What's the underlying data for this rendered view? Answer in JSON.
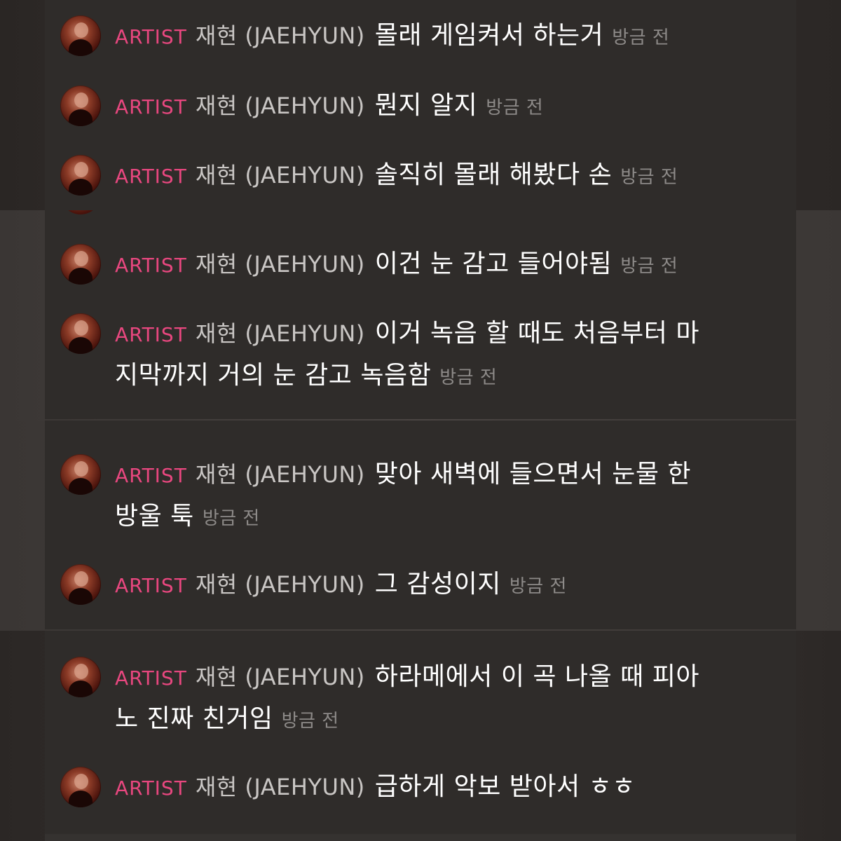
{
  "artist_badge": "ARTIST",
  "author_name": "재현 (JAEHYUN)",
  "messages": [
    {
      "text": "몰래 게임켜서 하는거",
      "time": "방금 전"
    },
    {
      "text": "뭔지 알지",
      "time": "방금 전"
    },
    {
      "text": "솔직히 몰래 해봤다 손",
      "time": "방금 전"
    },
    {
      "text": "이건 눈 감고 들어야됨",
      "time": "방금 전"
    },
    {
      "text": "이거 녹음 할 때도 처음부터 마지막까지 거의 눈 감고 녹음함",
      "time": "방금 전"
    },
    {
      "text": "맞아 새벽에 들으면서 눈물 한 방울 툭",
      "time": "방금 전"
    },
    {
      "text": "그 감성이지",
      "time": "방금 전"
    },
    {
      "text": "하라메에서 이 곡 나올 때 피아노 진짜 친거임",
      "time": "방금 전"
    },
    {
      "text": "급하게 악보 받아서 ㅎㅎ",
      "time": ""
    }
  ],
  "colors": {
    "badge": "#e8477f",
    "name": "#c9c6c4",
    "message": "#ffffff",
    "time": "#8d8a88",
    "panel": "#2f2c2a"
  }
}
